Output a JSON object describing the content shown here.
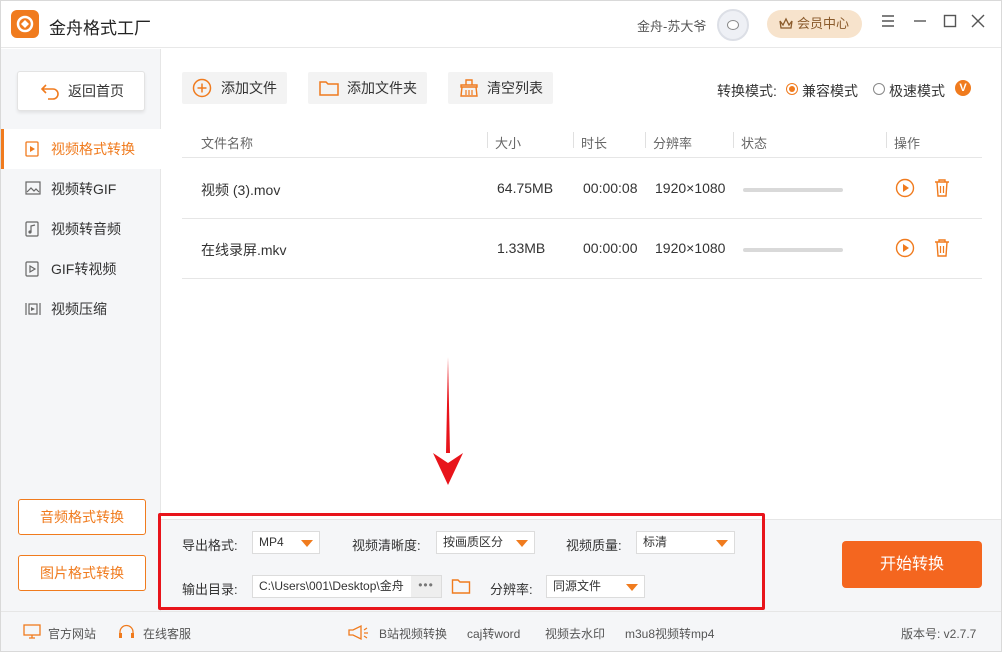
{
  "app": {
    "title": "金舟格式工厂",
    "username": "金舟-苏大爷",
    "vip_label": "会员中心"
  },
  "sidebar": {
    "back_label": "返回首页",
    "items": [
      {
        "label": "视频格式转换",
        "icon": "video-file-icon",
        "active": true
      },
      {
        "label": "视频转GIF",
        "icon": "image-icon",
        "active": false
      },
      {
        "label": "视频转音频",
        "icon": "music-file-icon",
        "active": false
      },
      {
        "label": "GIF转视频",
        "icon": "gif-video-icon",
        "active": false
      },
      {
        "label": "视频压缩",
        "icon": "compress-icon",
        "active": false
      }
    ],
    "audio_btn": "音频格式转换",
    "image_btn": "图片格式转换"
  },
  "toolbar": {
    "add_file": "添加文件",
    "add_folder": "添加文件夹",
    "clear_list": "清空列表"
  },
  "mode": {
    "label": "转换模式:",
    "options": [
      "兼容模式",
      "极速模式"
    ],
    "selected": "兼容模式",
    "badge": "V"
  },
  "table": {
    "headers": [
      "文件名称",
      "大小",
      "时长",
      "分辨率",
      "状态",
      "操作"
    ],
    "rows": [
      {
        "name": "视频 (3).mov",
        "size": "64.75MB",
        "duration": "00:00:08",
        "resolution": "1920×1080",
        "progress": 0
      },
      {
        "name": "在线录屏.mkv",
        "size": "1.33MB",
        "duration": "00:00:00",
        "resolution": "1920×1080",
        "progress": 0
      }
    ]
  },
  "settings": {
    "format_label": "导出格式:",
    "format_value": "MP4",
    "clarity_label": "视频清晰度:",
    "clarity_value": "按画质区分",
    "quality_label": "视频质量:",
    "quality_value": "标清",
    "output_label": "输出目录:",
    "output_value": "C:\\Users\\001\\Desktop\\金舟",
    "more": "•••",
    "resolution_label": "分辨率:",
    "resolution_value": "同源文件"
  },
  "start_label": "开始转换",
  "footer": {
    "website": "官方网站",
    "service": "在线客服",
    "links": [
      "B站视频转换",
      "caj转word",
      "视频去水印",
      "m3u8视频转mp4"
    ],
    "version": "版本号: v2.7.7"
  },
  "colors": {
    "accent": "#f07b1e",
    "start": "#f4661f",
    "highlight": "#e8141b"
  }
}
